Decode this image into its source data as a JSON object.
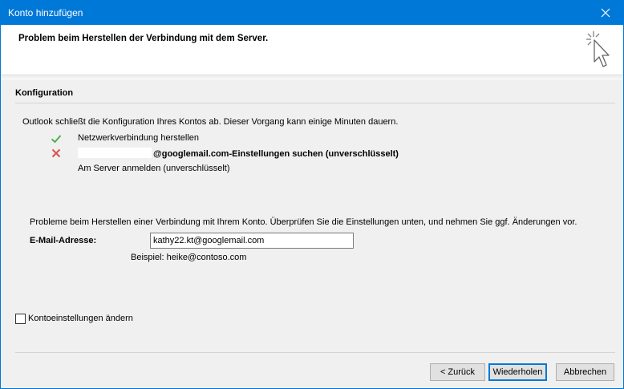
{
  "window": {
    "title": "Konto hinzufügen",
    "heading": "Problem beim Herstellen der Verbindung mit dem Server."
  },
  "config": {
    "section_title": "Konfiguration",
    "intro": "Outlook schließt die Konfiguration Ihres Kontos ab. Dieser Vorgang kann einige Minuten dauern.",
    "steps": [
      {
        "status": "success",
        "icon": "checkmark-icon",
        "text": "Netzwerkverbindung herstellen",
        "bold": false
      },
      {
        "status": "error",
        "icon": "error-x-icon",
        "text": "@googlemail.com-Einstellungen suchen (unverschlüsselt)",
        "bold": true
      },
      {
        "status": "pending",
        "icon": "",
        "text": "Am Server anmelden (unverschlüsselt)",
        "bold": false
      }
    ]
  },
  "problem": {
    "message": "Probleme beim Herstellen einer Verbindung mit Ihrem Konto. Überprüfen Sie die Einstellungen unten, und nehmen Sie ggf. Änderungen vor.",
    "email_label": "E-Mail-Adresse:",
    "email_value": "kathy22.kt@googlemail.com",
    "example": "Beispiel: heike@contoso.com"
  },
  "options": {
    "change_settings_label": "Kontoeinstellungen ändern",
    "change_settings_checked": false
  },
  "buttons": {
    "back": "< Zurück",
    "retry": "Wiederholen",
    "cancel": "Abbrechen"
  },
  "colors": {
    "titlebar": "#0078d7",
    "success": "#4caf50",
    "error": "#d9534f"
  }
}
